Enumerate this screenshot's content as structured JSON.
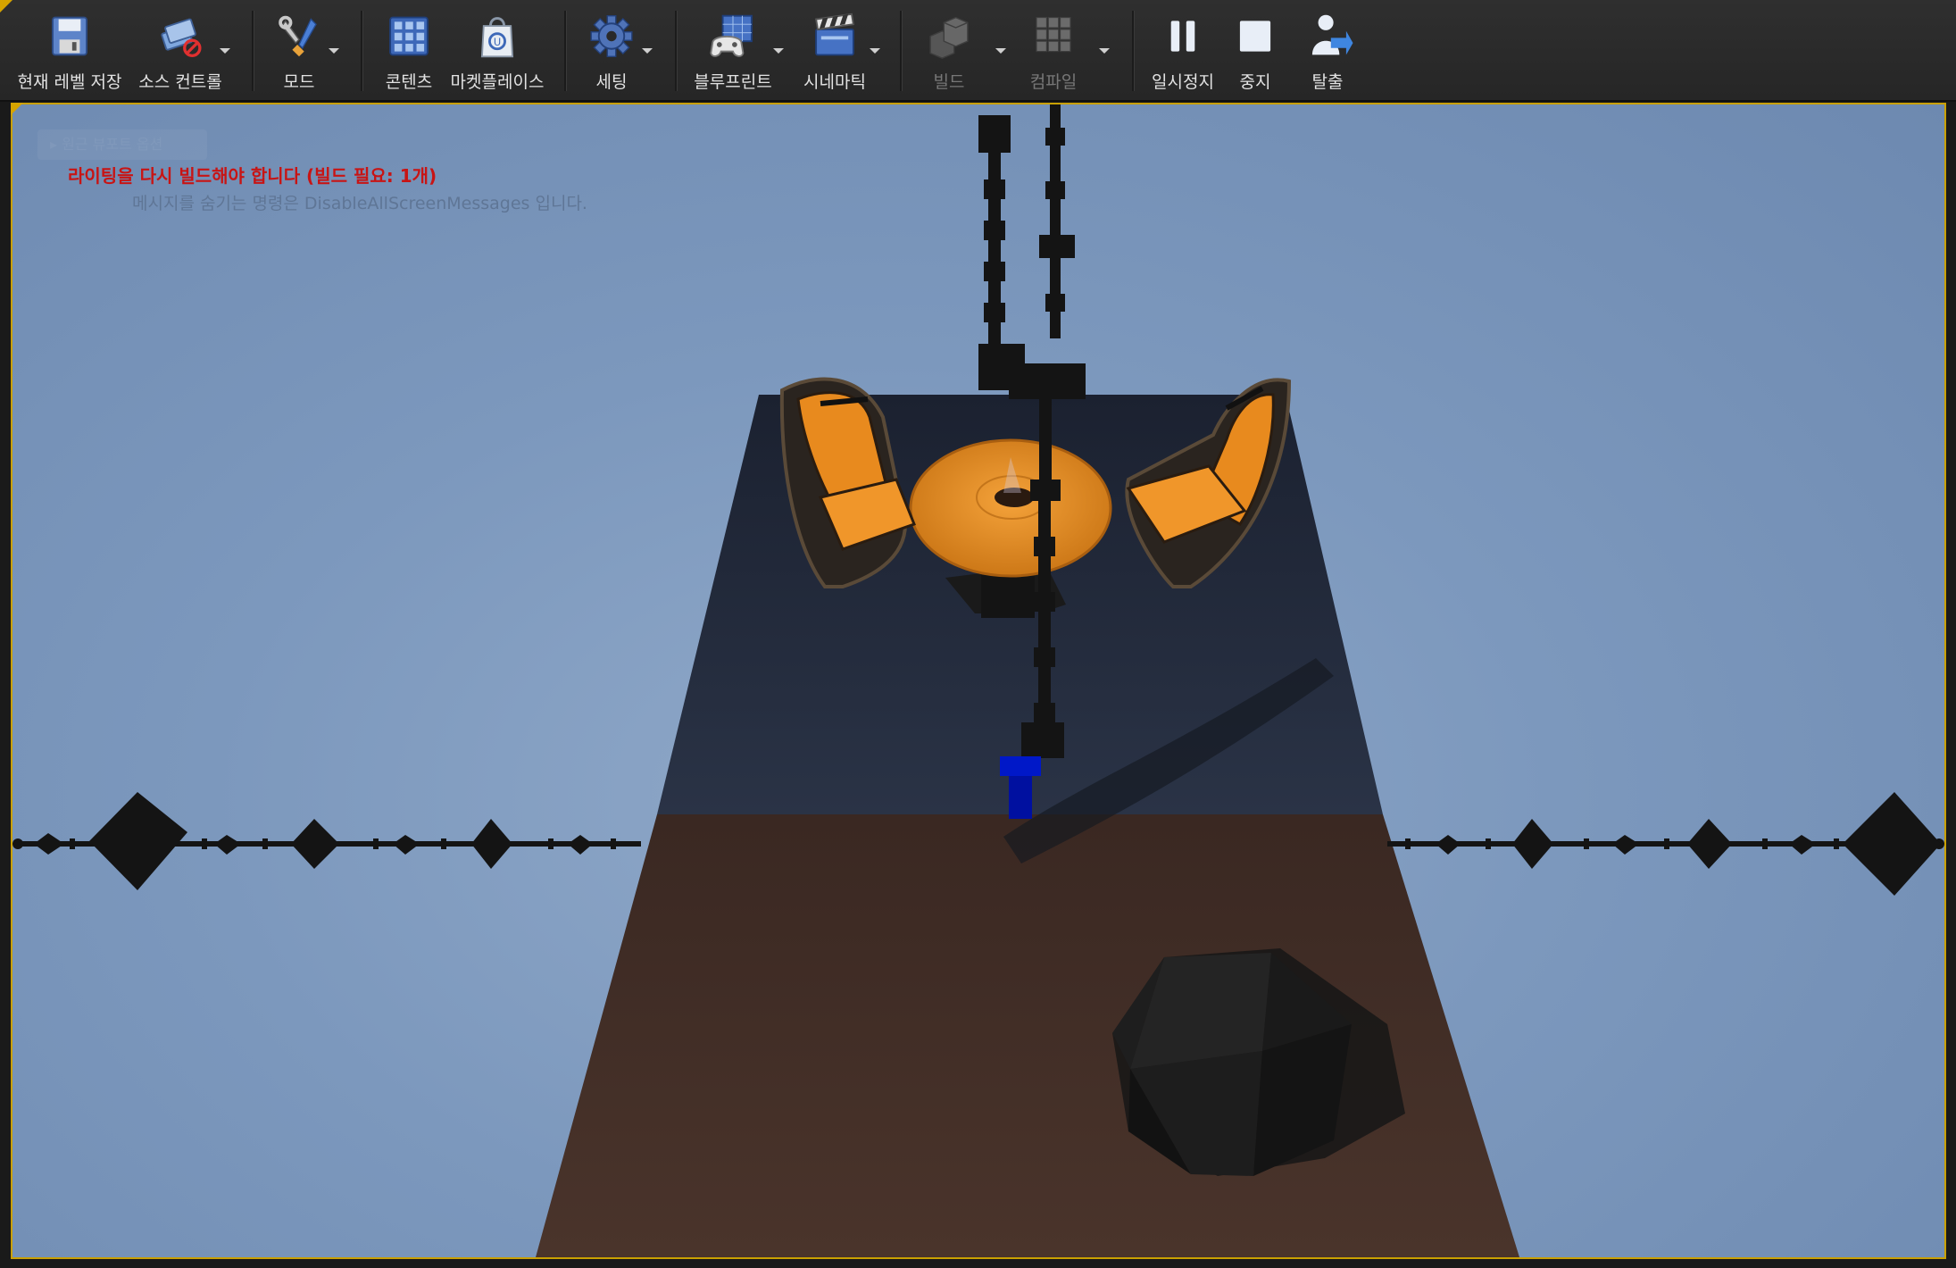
{
  "toolbar": {
    "buttons": [
      {
        "label": "현재 레벨 저장",
        "icon": "save-disk-icon"
      },
      {
        "label": "소스 컨트롤",
        "icon": "source-control-icon"
      },
      {
        "label": "모드",
        "icon": "modes-tools-icon"
      },
      {
        "label": "콘텐츠",
        "icon": "content-grid-icon"
      },
      {
        "label": "마켓플레이스",
        "icon": "marketplace-bag-icon"
      },
      {
        "label": "세팅",
        "icon": "settings-gear-icon"
      },
      {
        "label": "블루프린트",
        "icon": "blueprint-gamepad-icon"
      },
      {
        "label": "시네마틱",
        "icon": "cinematic-clapper-icon"
      },
      {
        "label": "빌드",
        "icon": "build-blocks-icon",
        "disabled": true
      },
      {
        "label": "컴파일",
        "icon": "compile-cubes-icon",
        "disabled": true
      },
      {
        "label": "일시정지",
        "icon": "pause-icon"
      },
      {
        "label": "중지",
        "icon": "stop-icon"
      },
      {
        "label": "탈출",
        "icon": "eject-icon"
      }
    ]
  },
  "viewport": {
    "options_hint": "▸ 원근 뷰포트 옵션",
    "warning": "라이팅을 다시 빌드해야 합니다 (빌드 필요: 1개)",
    "hint": "메시지를 숨기는 명령은 DisableAllScreenMessages 입니다."
  },
  "colors": {
    "sky": "#7f9bc0",
    "floor_dark": "#1f2533",
    "floor_brown": "#3b2a24",
    "chair_orange": "#e88a1e",
    "table_orange": "#e48a24",
    "gizmo_blue": "#0018c8",
    "warning_red": "#c81414",
    "frame_yellow": "#c9a000"
  }
}
